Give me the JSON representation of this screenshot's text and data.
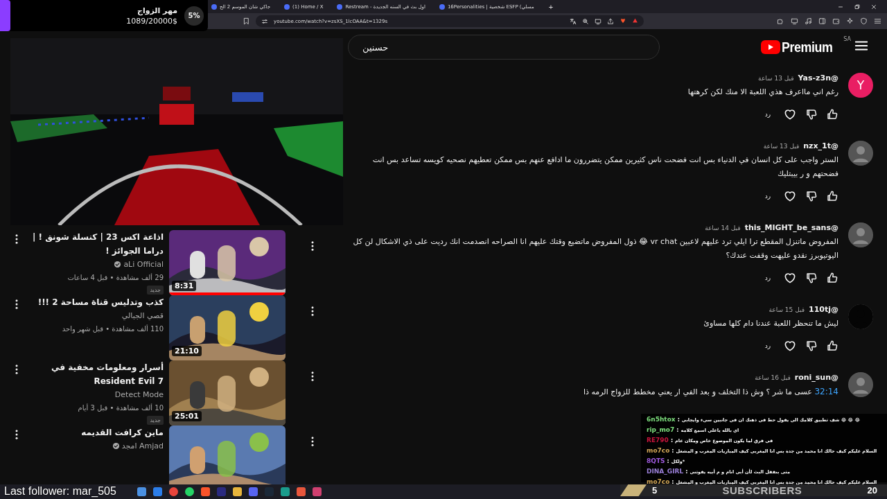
{
  "goal_overlay": {
    "title": "مهر الزواج",
    "amount": "1089/20000$",
    "percent": "5%"
  },
  "browser": {
    "tabs": [
      {
        "title": "16Personalities | شخصية ESFP (مسلي",
        "selected": false
      },
      {
        "title": "Restream - اول بث في السنه الجديدة",
        "selected": false
      },
      {
        "title": "(1) Home / X",
        "selected": false
      },
      {
        "title": "جاكي شان الموسم 2 الح",
        "selected": false
      }
    ],
    "new_tab": "+",
    "url": "youtube.com/watch?v=zsXS_1lcOAA&t=1329s"
  },
  "youtube": {
    "search_value": "حسنين",
    "logo": "Premium",
    "region": "SA"
  },
  "recommended": [
    {
      "title": "اذاعة اكس 23 | كنسلة شونق ! | دراما الجوائز !",
      "channel": "aLi Official",
      "verified": true,
      "meta": "29 ألف مشاهدة • قبل 4 ساعات",
      "badge": "جديد",
      "duration": "8:31",
      "level": 1
    },
    {
      "title": "كذب وتدليس قناة مساحة 2 !!!",
      "channel": "قصي الجبالي",
      "verified": false,
      "meta": "110 ألف مشاهدة • قبل شهر واحد",
      "duration": "21:10"
    },
    {
      "title": "أسرار ومعلومات مخفية في Resident Evil 7",
      "channel": "Detect Mode",
      "verified": false,
      "meta": "10 ألف مشاهدة • قبل 3 أيام",
      "badge": "جديد",
      "duration": "25:01"
    },
    {
      "title": "ماين كرافت القديمه",
      "channel": "Amjad امجد",
      "verified": true
    }
  ],
  "comments": [
    {
      "author": "@Yas-z3n",
      "time": "قبل 13 ساعة",
      "avatar_letter": "Y",
      "text": "رغم اني مااعرف هذي اللعبة الا منك لكن كرهتها",
      "reply": "رد"
    },
    {
      "author": "@nzx_1t",
      "time": "قبل 13 ساعة",
      "text": "الستر واجب على كل انسان في الدنياء بس  انت فضحت ناس كثيرين ممكن يتضررون ما ادافع عنهم بس ممكن تعطيهم نصحيه كويسه تساعد بس انت فضحتهم و ر بيبتليك",
      "reply": "رد"
    },
    {
      "author": "@this_MIGHT_be_sans",
      "time": "قبل 14 ساعة",
      "text": "المفروض ماتنزل المقطع ترا ايلي ترد عليهم لاعبين vr chat 😂 ذول المفروض ماتضيع وقتك عليهم انا الصراحه انصدمت انك رديت على ذي الاشكال لن كل اليوتيوبرز نقدو عليهت وقفت عندك؟",
      "reply": "رد"
    },
    {
      "author": "@110tj",
      "time": "قبل 15 ساعة",
      "text": "ليش ما تنحظر اللعبة عندنا دام كلها مساوئ",
      "reply": "رد"
    },
    {
      "author": "@roni_sun",
      "time": "قبل 16 ساعة",
      "timestamp": "32:14",
      "text": "عسى ما شر ؟ وش ذا التخلف و بعد الفي ار يعني مخطط للزواج الرمه ذا"
    }
  ],
  "chat": [
    {
      "user": "6n5htox",
      "separator": ":",
      "color": "#7ee07e",
      "text": "😂 😂 😂 شف تطبيق كلامك الي يقول حط في ذهنك ان في جانبين سيء وايجابي"
    },
    {
      "user": "rip_mo7",
      "separator": ":",
      "color": "#7ee07e",
      "text": "اي بالله ياعلي اسمع كلامه"
    },
    {
      "user": "RE790",
      "separator": ":",
      "color": "#c8143c",
      "text": "في فرق لما يكون الموضوع خاص ومكان عام"
    },
    {
      "user": "mo7co",
      "separator": ":",
      "color": "#d4a857",
      "text": "السلام عليكم كيف حالك انا محمد من جدة بس انا المغربي كيف المباريات المغرب و المشغل"
    },
    {
      "user": "8QTS",
      "separator": ":",
      "color": "#a05be0",
      "text": "*ولكل"
    },
    {
      "user": "DINA_GIRL",
      "separator": ":",
      "color": "#9a7fd8",
      "text": "متى بنقفل البث لأن أبي انام و م أبيه يفوتني"
    },
    {
      "user": "mo7co",
      "separator": ":",
      "color": "#d4a857",
      "text": "السلام عليكم كيف حالك انا محمد من جدة بس انا المغربي كيف المباريات المغرب و المشغل"
    }
  ],
  "subscriber_goal": {
    "current": "5",
    "label": "SUBSCRIBERS",
    "target": "20"
  },
  "follower_overlay": {
    "text": "Last follower: mar_505"
  }
}
